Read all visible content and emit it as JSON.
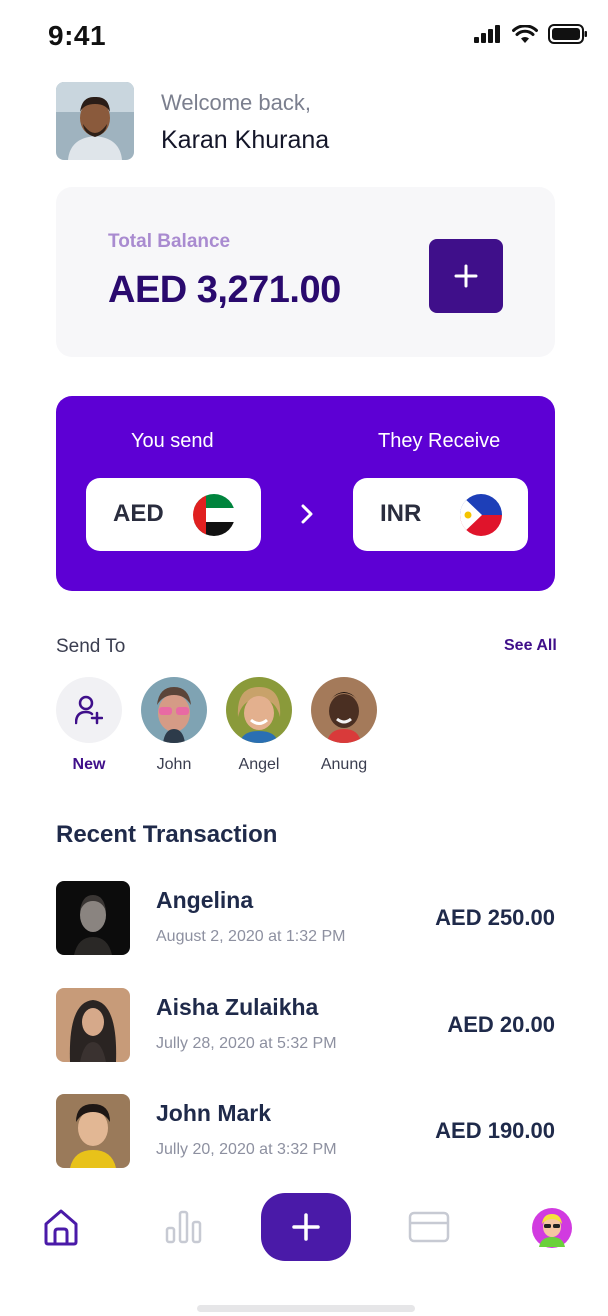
{
  "status_bar": {
    "time": "9:41"
  },
  "header": {
    "welcome": "Welcome back,",
    "user_name": "Karan Khurana"
  },
  "balance": {
    "label": "Total Balance",
    "amount": "AED 3,271.00"
  },
  "exchange": {
    "send_label": "You send",
    "receive_label": "They Receive",
    "from_currency": "AED",
    "to_currency": "INR"
  },
  "send_to": {
    "title": "Send To",
    "see_all": "See All",
    "contacts": [
      {
        "name": "New"
      },
      {
        "name": "John"
      },
      {
        "name": "Angel"
      },
      {
        "name": "Anung"
      }
    ]
  },
  "recent": {
    "title": "Recent Transaction",
    "items": [
      {
        "name": "Angelina",
        "date": "August 2, 2020 at 1:32 PM",
        "amount": "AED 250.00"
      },
      {
        "name": "Aisha Zulaikha",
        "date": "Jully 28, 2020 at 5:32 PM",
        "amount": "AED 20.00"
      },
      {
        "name": "John Mark",
        "date": "Jully 20, 2020 at 3:32 PM",
        "amount": "AED 190.00"
      }
    ]
  },
  "nav": {
    "items": [
      {
        "icon": "home-icon"
      },
      {
        "icon": "bar-chart-icon"
      },
      {
        "icon": "plus-icon"
      },
      {
        "icon": "card-icon"
      },
      {
        "icon": "profile-avatar"
      }
    ]
  },
  "colors": {
    "accent": "#5d00d4",
    "primary_dark": "#3f0f8a",
    "balance_label": "#a98bd0"
  }
}
